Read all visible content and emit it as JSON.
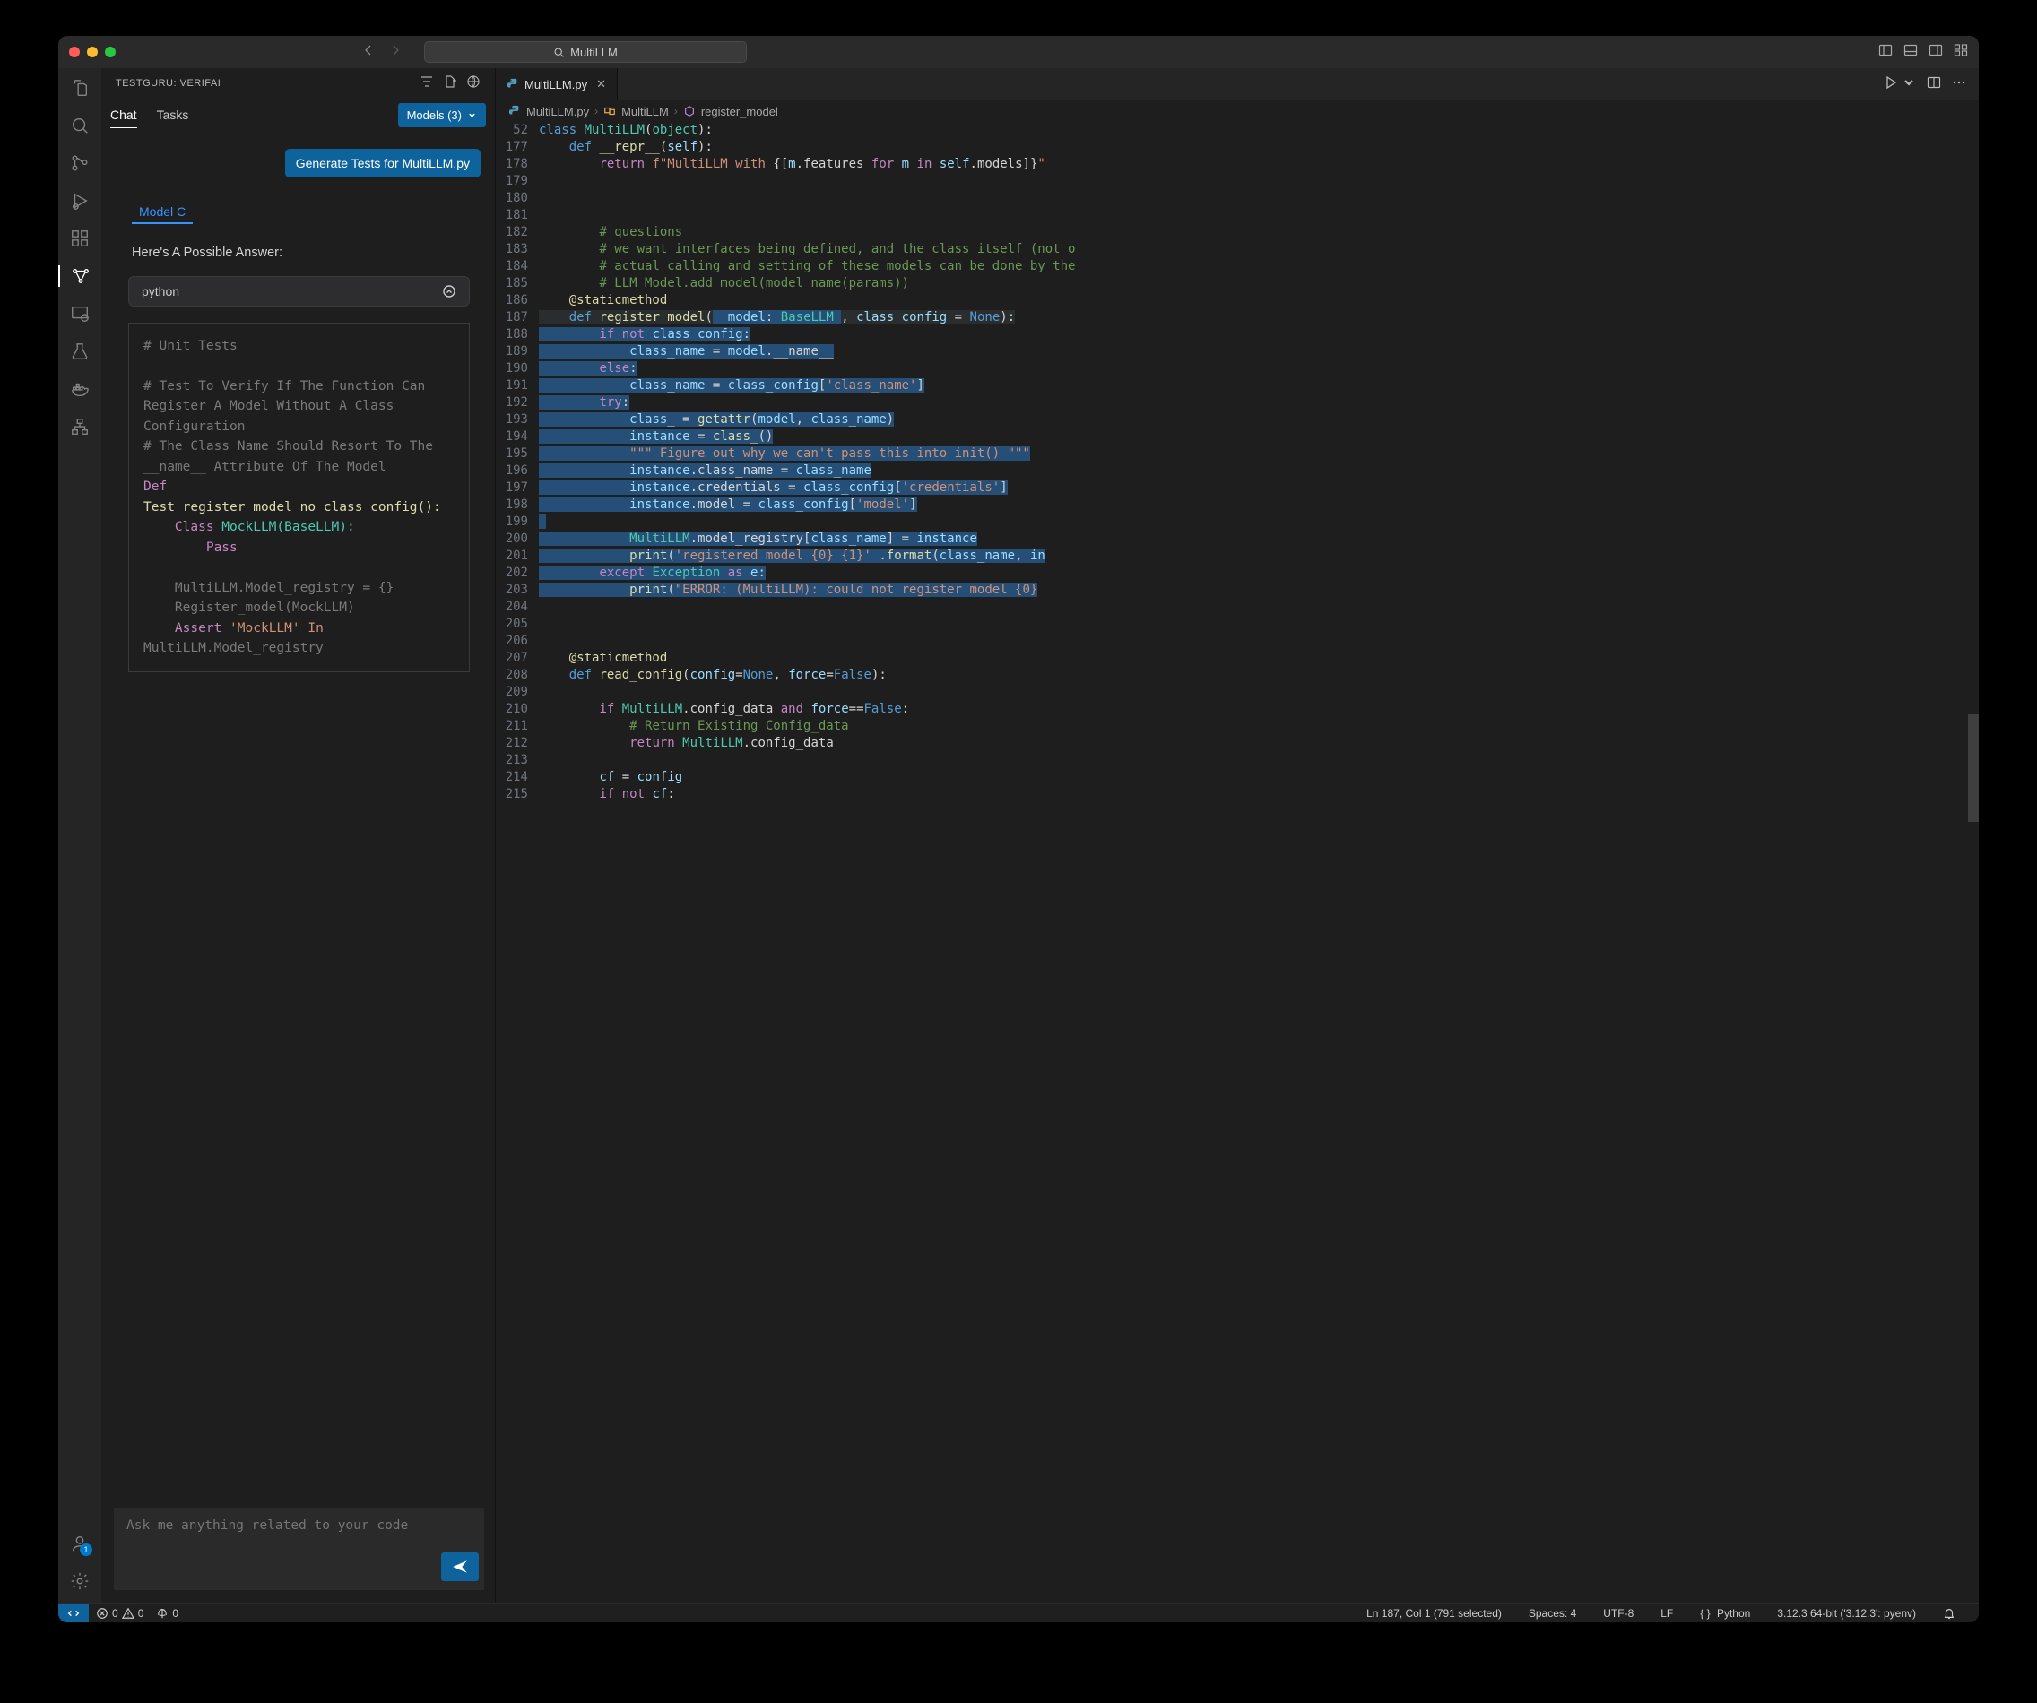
{
  "titlebar": {
    "search_text": "MultiLLM"
  },
  "sidepanel": {
    "title": "TESTGURU: VERIFAI",
    "tabs": {
      "chat": "Chat",
      "tasks": "Tasks"
    },
    "models_button": "Models (3)",
    "user_message": "Generate Tests for MultiLLM.py",
    "model_tab": "Model C",
    "answer_heading": "Here's A Possible Answer:",
    "lang_pill": "python",
    "code_block": "# Unit Tests\n\n# Test To Verify If The Function Can\nRegister A Model Without A Class\nConfiguration\n# The Class Name Should Resort To The\n__name__ Attribute Of The Model",
    "input_placeholder": "Ask me anything related to your code"
  },
  "editor": {
    "tab_name": "MultiLLM.py",
    "breadcrumbs": [
      "MultiLLM.py",
      "MultiLLM",
      "register_model"
    ],
    "first_line_no": "52",
    "line_numbers": [
      "177",
      "178",
      "179",
      "180",
      "181",
      "182",
      "183",
      "184",
      "185",
      "186",
      "187",
      "188",
      "189",
      "190",
      "191",
      "192",
      "193",
      "194",
      "195",
      "196",
      "197",
      "198",
      "199",
      "200",
      "201",
      "202",
      "203",
      "204",
      "205",
      "206",
      "207",
      "208",
      "209",
      "210",
      "211",
      "212",
      "213",
      "214",
      "215"
    ]
  },
  "statusbar": {
    "errors": "0",
    "warnings": "0",
    "ports": "0",
    "cursor": "Ln 187, Col 1 (791 selected)",
    "spaces": "Spaces: 4",
    "encoding": "UTF-8",
    "eol": "LF",
    "lang": "Python",
    "interpreter": "3.12.3 64-bit ('3.12.3': pyenv)"
  },
  "code_lines": {
    "l52": "class MultiLLM(object):",
    "l177": "    def __repr__(self):",
    "l178": "        return f\"MultiLLM with {[m.features for m in self.models]}\"",
    "l182": "        # questions",
    "l183": "        # we want interfaces being defined, and the class itself (not o",
    "l184": "        # actual calling and setting of these models can be done by the",
    "l185": "        # LLM_Model.add_model(model_name(params))",
    "l186": "    @staticmethod",
    "l187": "    def register_model(  model: BaseLLM , class_config = None):",
    "l188": "        if not class_config:",
    "l189": "            class_name = model.__name__",
    "l190": "        else:",
    "l191": "            class_name = class_config['class_name']",
    "l192": "        try:",
    "l193": "            class_ = getattr(model, class_name)",
    "l194": "            instance = class_()",
    "l195": "            \"\"\" Figure out why we can't pass this into init() \"\"\"",
    "l196": "            instance.class_name = class_name",
    "l197": "            instance.credentials = class_config['credentials']",
    "l198": "            instance.model = class_config['model']",
    "l200": "            MultiLLM.model_registry[class_name] = instance",
    "l201": "            print('registered model {0} {1}' .format(class_name, in",
    "l202": "        except Exception as e:",
    "l203": "            print(\"ERROR: (MultiLLM): could not register model {0}",
    "l207": "    @staticmethod",
    "l208": "    def read_config(config=None, force=False):",
    "l210": "        if MultiLLM.config_data and force==False:",
    "l211": "            # Return Existing Config_data",
    "l212": "            return MultiLLM.config_data",
    "l214": "        cf = config",
    "l215": "        if not cf:"
  },
  "test_code": {
    "def": "Def",
    "fn_line": "Test_register_model_no_class_config():",
    "class_line_kw": "Class",
    "class_line_rest": " MockLLM(BaseLLM):",
    "pass": "Pass",
    "reg_reset": "    MultiLLM.Model_registry = {}",
    "reg_call": "    Register_model(MockLLM)",
    "assert_kw": "Assert",
    "assert_rest": " 'MockLLM' In",
    "last": "MultiLLM.Model_registry"
  }
}
